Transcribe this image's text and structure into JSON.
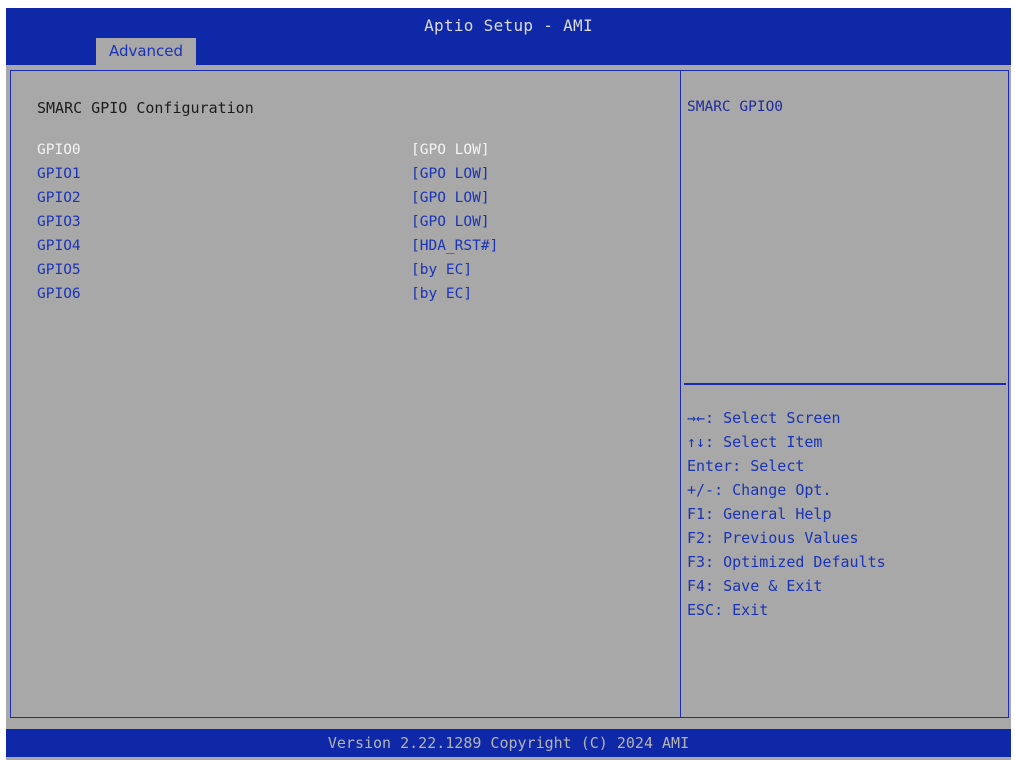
{
  "header": {
    "title": "Aptio Setup - AMI",
    "active_tab": "Advanced"
  },
  "main": {
    "page_title": "SMARC GPIO Configuration",
    "items": [
      {
        "name": "GPIO0",
        "value": "[GPO LOW]",
        "selected": true
      },
      {
        "name": "GPIO1",
        "value": "[GPO LOW]",
        "selected": false
      },
      {
        "name": "GPIO2",
        "value": "[GPO LOW]",
        "selected": false
      },
      {
        "name": "GPIO3",
        "value": "[GPO LOW]",
        "selected": false
      },
      {
        "name": "GPIO4",
        "value": "[HDA_RST#]",
        "selected": false
      },
      {
        "name": "GPIO5",
        "value": "[by EC]",
        "selected": false
      },
      {
        "name": "GPIO6",
        "value": "[by EC]",
        "selected": false
      }
    ]
  },
  "help": {
    "title": "SMARC GPIO0",
    "keys": [
      "→←: Select Screen",
      "↑↓: Select Item",
      "Enter: Select",
      "+/-: Change Opt.",
      "F1: General Help",
      "F2: Previous Values",
      "F3: Optimized Defaults",
      "F4: Save & Exit",
      "ESC: Exit"
    ]
  },
  "footer": {
    "version_text": "Version 2.22.1289 Copyright (C) 2024 AMI"
  },
  "colors": {
    "header_bg": "#0f28a8",
    "panel_bg": "#a8a8a8",
    "item_text": "#1a33b5",
    "selected_text": "#f4f4f4"
  }
}
